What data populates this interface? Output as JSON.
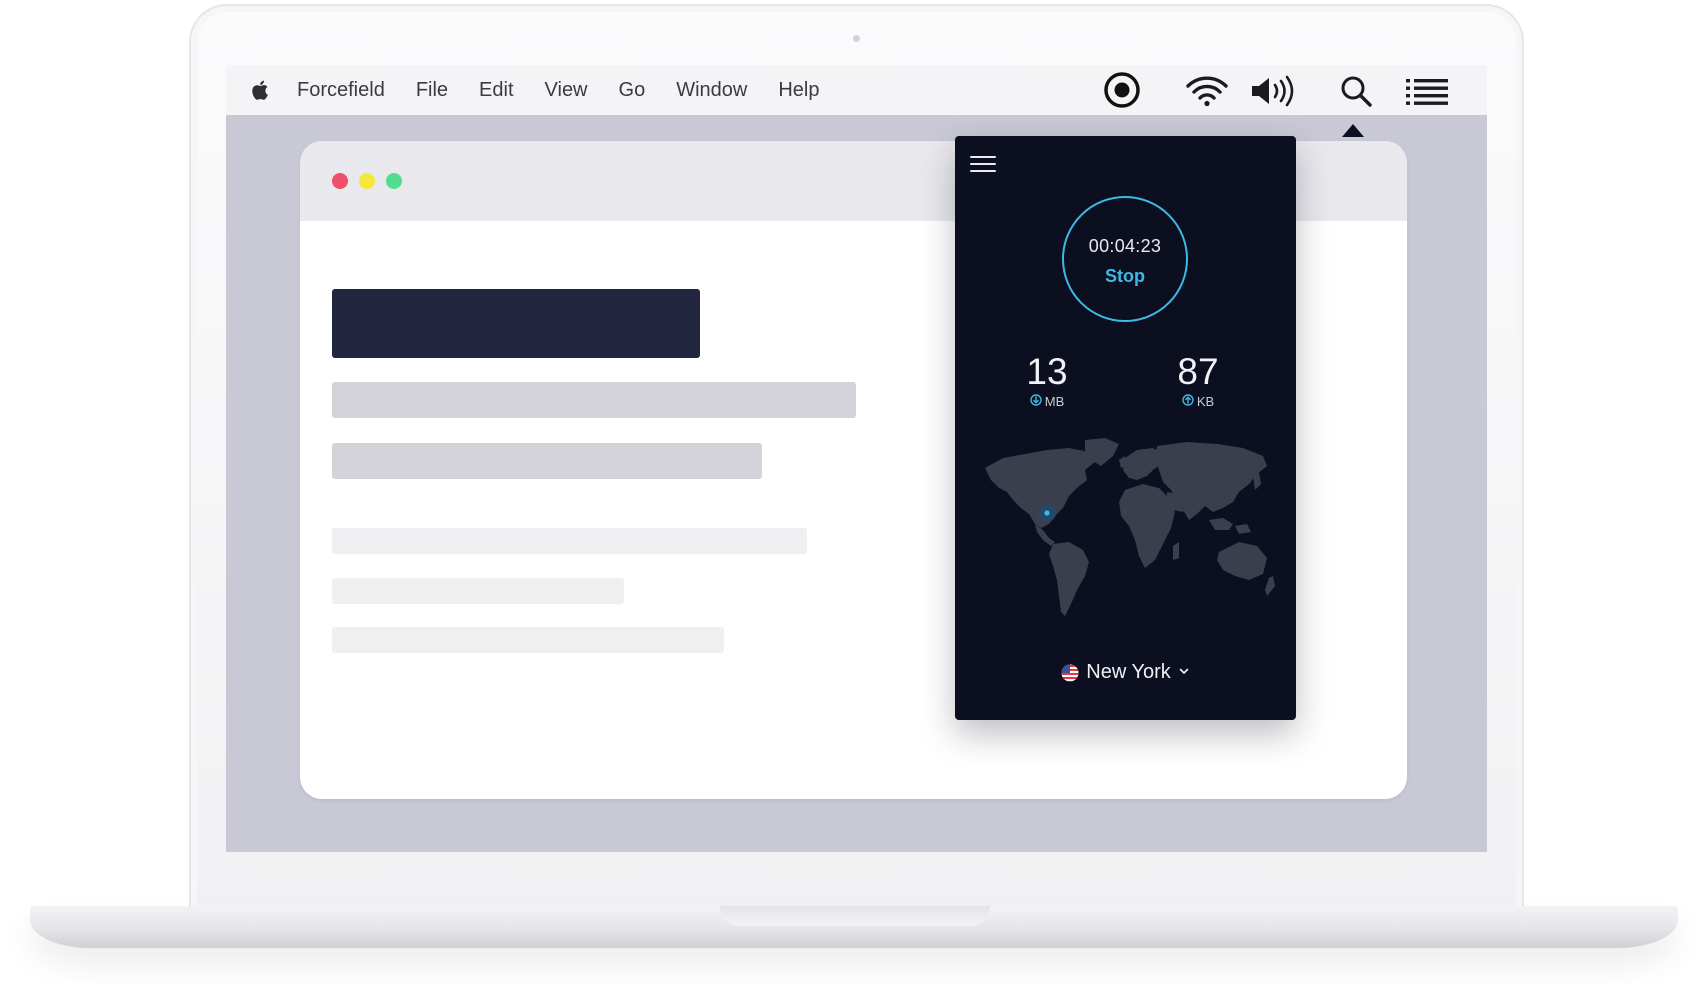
{
  "menubar": {
    "app_name": "Forcefield",
    "items": [
      "File",
      "Edit",
      "View",
      "Go",
      "Window",
      "Help"
    ]
  },
  "status_icons": [
    "forcefield-logo-icon",
    "wifi-icon",
    "volume-icon",
    "search-icon",
    "list-icon"
  ],
  "popover": {
    "timer": "00:04:23",
    "action_label": "Stop",
    "download": {
      "value": "13",
      "unit": "MB"
    },
    "upload": {
      "value": "87",
      "unit": "KB"
    },
    "location": "New York"
  },
  "colors": {
    "accent": "#3fb8e5",
    "popover_bg": "#0b0f1f",
    "screen_bg": "#c9c9d6",
    "traffic_red": "#ef4f6a",
    "traffic_yellow": "#f5e83a",
    "traffic_green": "#4fde8e"
  }
}
